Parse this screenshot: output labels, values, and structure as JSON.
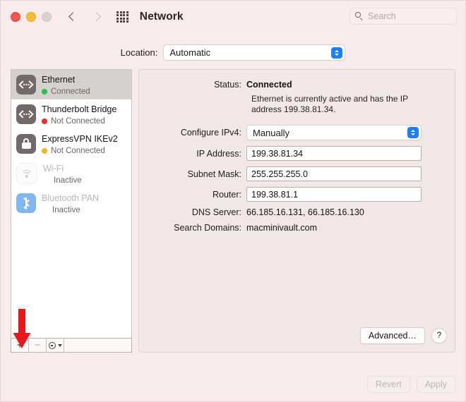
{
  "window": {
    "title": "Network",
    "traffic_lights": [
      "close-button",
      "minimize-button",
      "zoom-button"
    ],
    "back_label": "",
    "forward_label": "",
    "grid_icon": "grid-icon"
  },
  "search": {
    "placeholder": "Search",
    "value": "",
    "icon": "search-icon"
  },
  "location": {
    "label": "Location:",
    "value": "Automatic"
  },
  "sidebar": {
    "services": [
      {
        "name": "Ethernet",
        "status": "Connected",
        "dot": "green",
        "dot_color": "#27c33f",
        "icon": "ethernet-icon",
        "selected": true,
        "inactive": false
      },
      {
        "name": "Thunderbolt Bridge",
        "status": "Not Connected",
        "dot": "red",
        "dot_color": "#f02d22",
        "icon": "ethernet-icon",
        "selected": false,
        "inactive": false
      },
      {
        "name": "ExpressVPN IKEv2",
        "status": "Not Connected",
        "dot": "orange",
        "dot_color": "#f2b327",
        "icon": "lock-icon",
        "selected": false,
        "inactive": false
      },
      {
        "name": "Wi-Fi",
        "status": "Inactive",
        "dot": "none",
        "dot_color": "",
        "icon": "wifi-icon",
        "selected": false,
        "inactive": true
      },
      {
        "name": "Bluetooth PAN",
        "status": "Inactive",
        "dot": "none",
        "dot_color": "",
        "icon": "bluetooth-icon",
        "selected": false,
        "inactive": true
      }
    ],
    "toolbar": {
      "add_label": "+",
      "remove_label": "−",
      "action_icon": "gear-icon"
    }
  },
  "detail": {
    "status_label": "Status:",
    "status_value": "Connected",
    "description": "Ethernet is currently active and has the IP address 199.38.81.34.",
    "configure_label": "Configure IPv4:",
    "configure_value": "Manually",
    "ip_label": "IP Address:",
    "ip_value": "199.38.81.34",
    "subnet_label": "Subnet Mask:",
    "subnet_value": "255.255.255.0",
    "router_label": "Router:",
    "router_value": "199.38.81.1",
    "dns_label": "DNS Server:",
    "dns_value": "66.185.16.131, 66.185.16.130",
    "search_domains_label": "Search Domains:",
    "search_domains_value": "macminivault.com",
    "advanced_label": "Advanced…",
    "help_label": "?"
  },
  "footer": {
    "revert_label": "Revert",
    "apply_label": "Apply"
  },
  "annotation": {
    "arrow_color": "#e8171a",
    "points_to": "add-service-button"
  }
}
